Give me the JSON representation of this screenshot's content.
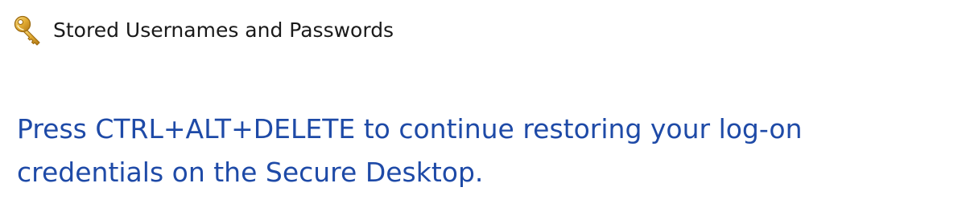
{
  "window": {
    "title": "Stored Usernames and Passwords",
    "icon": "key-icon"
  },
  "main": {
    "instruction": "Press CTRL+ALT+DELETE to continue restoring your log-on credentials on the Secure Desktop."
  },
  "colors": {
    "instruction_text": "#1e4aa7",
    "title_text": "#1a1a1a",
    "key_gold": "#d9a528"
  }
}
